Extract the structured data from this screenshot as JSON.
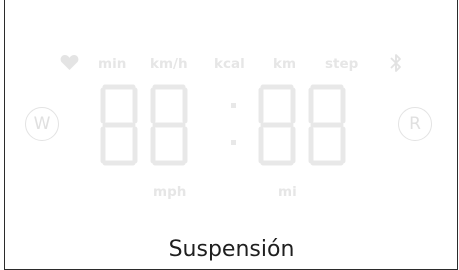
{
  "display": {
    "top_units": [
      "min",
      "km/h",
      "kcal",
      "km",
      "step"
    ],
    "bottom_units": [
      "mph",
      "mi"
    ],
    "clock_value": "88:88",
    "left_button": "W",
    "right_button": "R",
    "icons": [
      "heart-icon",
      "bluetooth-icon"
    ],
    "segment_color": "#e6e6e6"
  },
  "status": {
    "label": "Suspensión"
  }
}
